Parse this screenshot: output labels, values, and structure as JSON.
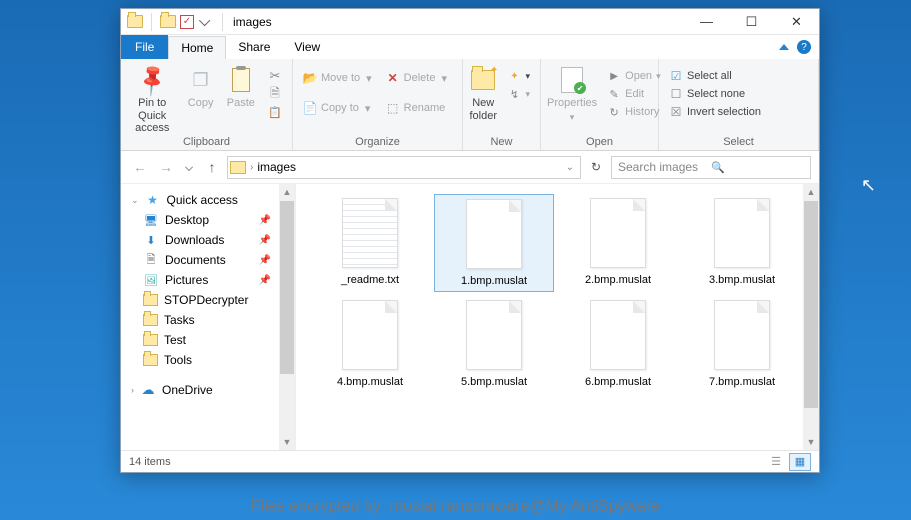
{
  "window": {
    "title": "images",
    "controls": {
      "minimize": "—",
      "maximize": "☐",
      "close": "✕"
    }
  },
  "tabs": {
    "file": "File",
    "home": "Home",
    "share": "Share",
    "view": "View"
  },
  "ribbon": {
    "clipboard": {
      "label": "Clipboard",
      "pin_to_quick_access": "Pin to Quick\naccess",
      "copy": "Copy",
      "paste": "Paste"
    },
    "organize": {
      "label": "Organize",
      "move_to": "Move to",
      "copy_to": "Copy to",
      "delete": "Delete",
      "rename": "Rename"
    },
    "new": {
      "label": "New",
      "new_folder": "New\nfolder",
      "new_item": "New item",
      "easy_access": "Easy access"
    },
    "open": {
      "label": "Open",
      "properties": "Properties",
      "open": "Open",
      "edit": "Edit",
      "history": "History"
    },
    "select": {
      "label": "Select",
      "select_all": "Select all",
      "select_none": "Select none",
      "invert_selection": "Invert selection"
    }
  },
  "address": {
    "path": "images"
  },
  "search": {
    "placeholder": "Search images"
  },
  "sidebar": {
    "quick_access": "Quick access",
    "items": [
      {
        "label": "Desktop",
        "icon": "desk-ico",
        "pinned": true
      },
      {
        "label": "Downloads",
        "icon": "dl-ico",
        "pinned": true
      },
      {
        "label": "Documents",
        "icon": "doc-ico",
        "pinned": true
      },
      {
        "label": "Pictures",
        "icon": "pic-ico",
        "pinned": true
      },
      {
        "label": "STOPDecrypter",
        "icon": "fold-ico",
        "pinned": false
      },
      {
        "label": "Tasks",
        "icon": "fold-ico",
        "pinned": false
      },
      {
        "label": "Test",
        "icon": "fold-ico",
        "pinned": false
      },
      {
        "label": "Tools",
        "icon": "fold-ico",
        "pinned": false
      }
    ],
    "onedrive": "OneDrive"
  },
  "files": [
    {
      "name": "_readme.txt",
      "type": "txt",
      "selected": false
    },
    {
      "name": "1.bmp.muslat",
      "type": "blank",
      "selected": true
    },
    {
      "name": "2.bmp.muslat",
      "type": "blank",
      "selected": false
    },
    {
      "name": "3.bmp.muslat",
      "type": "blank",
      "selected": false
    },
    {
      "name": "4.bmp.muslat",
      "type": "blank",
      "selected": false
    },
    {
      "name": "5.bmp.muslat",
      "type": "blank",
      "selected": false
    },
    {
      "name": "6.bmp.muslat",
      "type": "blank",
      "selected": false
    },
    {
      "name": "7.bmp.muslat",
      "type": "blank",
      "selected": false
    }
  ],
  "status": {
    "item_count": "14 items"
  },
  "caption": "Files encrypted by .muslat ransomware@My AntiSpyware"
}
